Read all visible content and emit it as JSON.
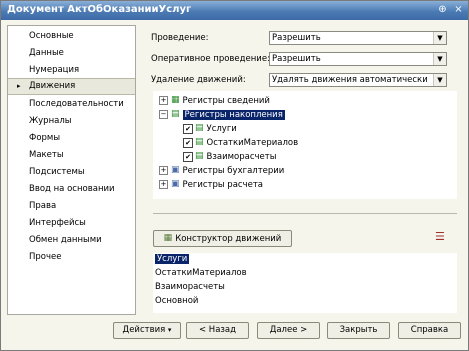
{
  "window": {
    "title": "Документ АктОбОказанииУслуг",
    "pin_glyph": "⊕",
    "close_glyph": "×"
  },
  "nav": {
    "items": [
      {
        "label": "Основные"
      },
      {
        "label": "Данные"
      },
      {
        "label": "Нумерация"
      },
      {
        "label": "Движения",
        "active": true
      },
      {
        "label": "Последовательности"
      },
      {
        "label": "Журналы"
      },
      {
        "label": "Формы"
      },
      {
        "label": "Макеты"
      },
      {
        "label": "Подсистемы"
      },
      {
        "label": "Ввод на основании"
      },
      {
        "label": "Права"
      },
      {
        "label": "Интерфейсы"
      },
      {
        "label": "Обмен данными"
      },
      {
        "label": "Прочее"
      }
    ],
    "active_arrow": "▸"
  },
  "fields": {
    "posting": {
      "label": "Проведение:",
      "value": "Разрешить"
    },
    "operational": {
      "label": "Оперативное проведение:",
      "value": "Разрешить"
    },
    "delete_moves": {
      "label": "Удаление движений:",
      "value": "Удалять движения автоматически"
    }
  },
  "tree": {
    "info_registers": "Регистры сведений",
    "accum_registers": "Регистры накопления",
    "accum_children": [
      "Услуги",
      "ОстаткиМатериалов",
      "Взаиморасчеты"
    ],
    "accounting_registers": "Регистры бухгалтерии",
    "calc_registers": "Регистры расчета"
  },
  "moves_constructor": {
    "label": "Конструктор движений"
  },
  "moves_list": [
    "Услуги",
    "ОстаткиМатериалов",
    "Взаиморасчеты",
    "Основной"
  ],
  "buttons": {
    "actions": "Действия",
    "back": "< Назад",
    "next": "Далее >",
    "close": "Закрыть",
    "help": "Справка"
  }
}
